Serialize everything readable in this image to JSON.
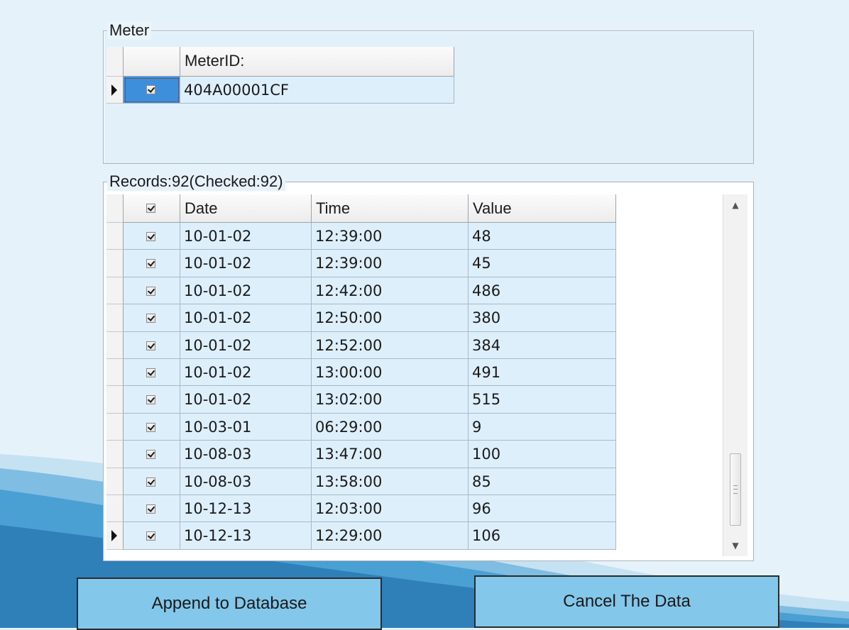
{
  "meter": {
    "title": "Meter",
    "column_header": "MeterID:",
    "rows": [
      {
        "checked": true,
        "meter_id": "404A00001CF",
        "current": true
      }
    ]
  },
  "records": {
    "title": "Records:92(Checked:92)",
    "columns": [
      "Date",
      "Time",
      "Value"
    ],
    "rows": [
      {
        "checked": true,
        "date": "10-01-02",
        "time": "12:39:00",
        "value": "48"
      },
      {
        "checked": true,
        "date": "10-01-02",
        "time": "12:39:00",
        "value": "45"
      },
      {
        "checked": true,
        "date": "10-01-02",
        "time": "12:42:00",
        "value": "486"
      },
      {
        "checked": true,
        "date": "10-01-02",
        "time": "12:50:00",
        "value": "380"
      },
      {
        "checked": true,
        "date": "10-01-02",
        "time": "12:52:00",
        "value": "384"
      },
      {
        "checked": true,
        "date": "10-01-02",
        "time": "13:00:00",
        "value": "491"
      },
      {
        "checked": true,
        "date": "10-01-02",
        "time": "13:02:00",
        "value": "515"
      },
      {
        "checked": true,
        "date": "10-03-01",
        "time": "06:29:00",
        "value": "9"
      },
      {
        "checked": true,
        "date": "10-08-03",
        "time": "13:47:00",
        "value": "100"
      },
      {
        "checked": true,
        "date": "10-08-03",
        "time": "13:58:00",
        "value": "85"
      },
      {
        "checked": true,
        "date": "10-12-13",
        "time": "12:03:00",
        "value": "96"
      },
      {
        "checked": true,
        "date": "10-12-13",
        "time": "12:29:00",
        "value": "106",
        "current": true
      }
    ]
  },
  "buttons": {
    "append_label": "Append to Database",
    "cancel_label": "Cancel The Data"
  },
  "colors": {
    "background": "#e6f2fa",
    "cell": "#ddeffb",
    "selected": "#3d8fdc",
    "button": "#83c7ea"
  }
}
